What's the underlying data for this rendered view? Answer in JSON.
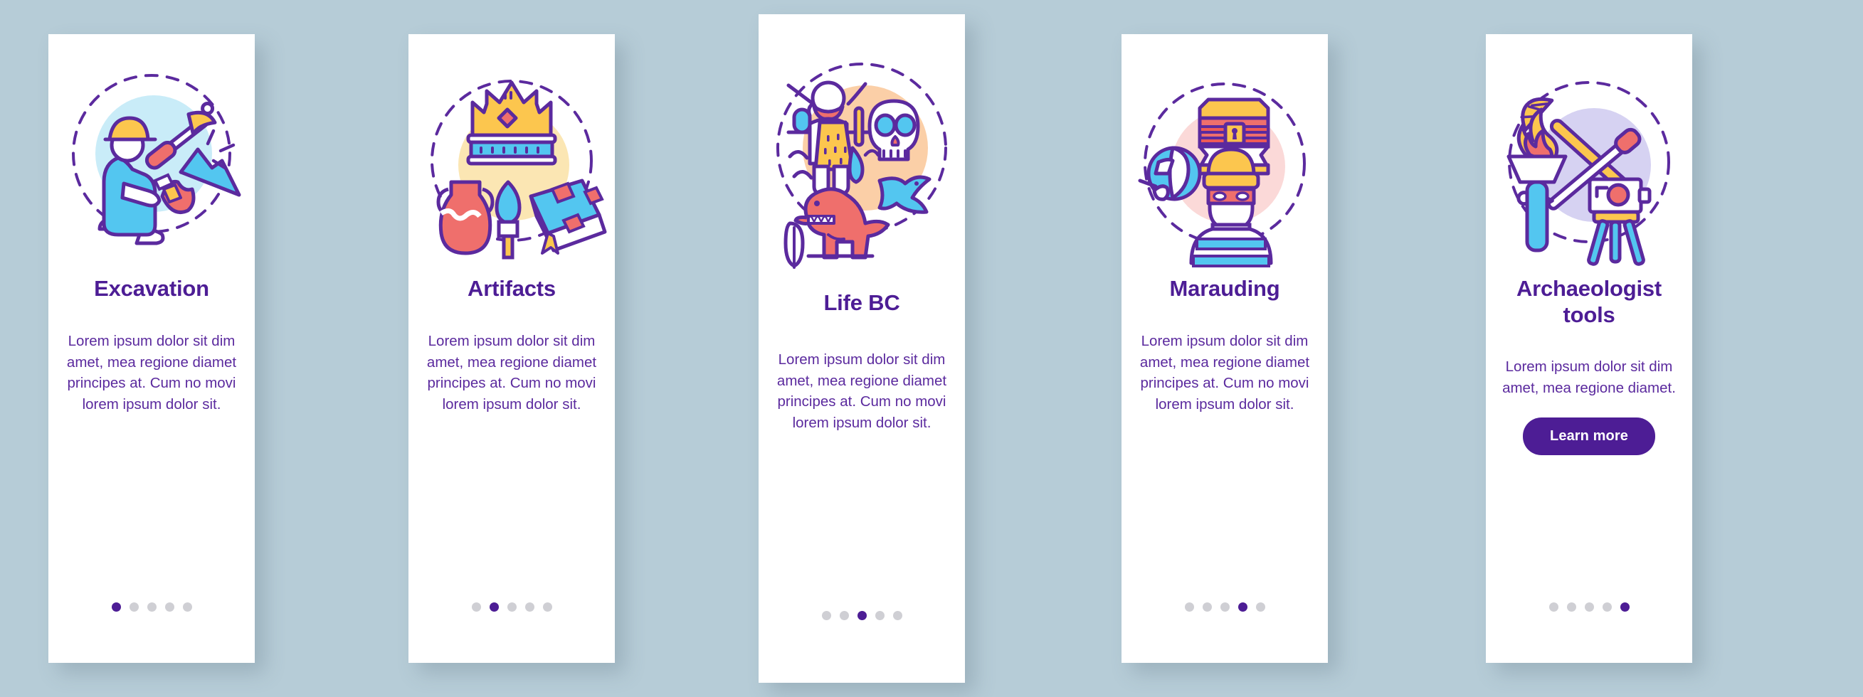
{
  "background_color": "#b6ccd7",
  "theme": {
    "card_background": "#ffffff",
    "title_color": "#4d1d95",
    "body_color": "#5b2a9e",
    "accent_purple": "#4d1d95",
    "outline_purple": "#5b2a9e",
    "dot_inactive": "#cfcfd4",
    "blue": "#53c6f0",
    "light_blue": "#c9ecf8",
    "yellow": "#fcc64e",
    "light_yellow": "#fbe6b3",
    "red": "#ef6f6c",
    "pink_blob": "#fbd9d8",
    "orange_blob": "#fbcfa7",
    "lilac_blob": "#d6d2f2"
  },
  "screens": [
    {
      "id": "excavation",
      "title": "Excavation",
      "body": "Lorem ipsum dolor sit dim amet, mea regione diamet principes at. Cum no movi lorem ipsum dolor sit.",
      "illustration_name": "excavation-illustration",
      "illustration_items": [
        "archaeologist-digging",
        "pickaxe",
        "mountain-rock",
        "brush",
        "hard-hat"
      ],
      "blob_color": "#c9ecf8",
      "dots": {
        "count": 5,
        "active_index": 0
      },
      "has_button": false,
      "tall": false
    },
    {
      "id": "artifacts",
      "title": "Artifacts",
      "body": "Lorem ipsum dolor sit dim amet, mea regione diamet principes at. Cum no movi lorem ipsum dolor sit.",
      "illustration_name": "artifacts-illustration",
      "illustration_items": [
        "crown",
        "amphora-vase",
        "spear-head",
        "ancient-book"
      ],
      "blob_color": "#fbe6b3",
      "dots": {
        "count": 5,
        "active_index": 1
      },
      "has_button": false,
      "tall": false
    },
    {
      "id": "life-bc",
      "title": "Life BC",
      "body": "Lorem ipsum dolor sit dim amet, mea regione diamet principes at. Cum no movi lorem ipsum dolor sit.",
      "illustration_name": "life-bc-illustration",
      "illustration_items": [
        "caveman",
        "skull",
        "dinosaur",
        "pterodactyl",
        "feather",
        "cave-painting"
      ],
      "blob_color": "#fbcfa7",
      "dots": {
        "count": 5,
        "active_index": 2
      },
      "has_button": false,
      "tall": true
    },
    {
      "id": "marauding",
      "title": "Marauding",
      "body": "Lorem ipsum dolor sit dim amet, mea regione diamet principes at. Cum no movi lorem ipsum dolor sit.",
      "illustration_name": "marauding-illustration",
      "illustration_items": [
        "treasure-chest",
        "masked-thief",
        "broken-vase"
      ],
      "blob_color": "#fbd9d8",
      "dots": {
        "count": 5,
        "active_index": 3
      },
      "has_button": false,
      "tall": false
    },
    {
      "id": "archaeologist-tools",
      "title": "Archaeologist tools",
      "body": "Lorem ipsum dolor sit dim amet, mea regione diamet.",
      "illustration_name": "archaeologist-tools-illustration",
      "illustration_items": [
        "torch-flame",
        "pickaxe",
        "brush",
        "camera-tripod"
      ],
      "blob_color": "#d6d2f2",
      "dots": {
        "count": 5,
        "active_index": 4
      },
      "has_button": true,
      "button_label": "Learn more",
      "tall": false
    }
  ]
}
